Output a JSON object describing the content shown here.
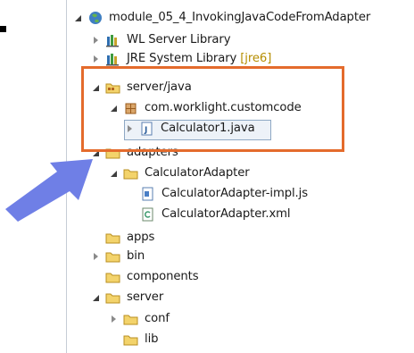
{
  "tree": {
    "root": {
      "label": "module_05_4_InvokingJavaCodeFromAdapter",
      "icon": "project-globe-icon"
    },
    "items": [
      {
        "label": "WL Server Library",
        "icon": "library-icon"
      },
      {
        "label": "JRE System Library",
        "decoration": "[jre6]",
        "icon": "library-icon"
      },
      {
        "label": "server/java",
        "icon": "source-folder-icon"
      },
      {
        "label": "com.worklight.customcode",
        "icon": "package-icon"
      },
      {
        "label": "Calculator1.java",
        "icon": "java-file-icon"
      },
      {
        "label": "adapters",
        "icon": "folder-icon"
      },
      {
        "label": "CalculatorAdapter",
        "icon": "folder-icon"
      },
      {
        "label": "CalculatorAdapter-impl.js",
        "icon": "js-file-icon"
      },
      {
        "label": "CalculatorAdapter.xml",
        "icon": "xml-file-icon"
      },
      {
        "label": "apps",
        "icon": "folder-icon"
      },
      {
        "label": "bin",
        "icon": "folder-icon"
      },
      {
        "label": "components",
        "icon": "folder-icon"
      },
      {
        "label": "server",
        "icon": "folder-icon"
      },
      {
        "label": "conf",
        "icon": "folder-icon"
      },
      {
        "label": "lib",
        "icon": "folder-icon"
      }
    ]
  },
  "colors": {
    "highlight_box": "#e46b2c",
    "pointer_arrow": "#6f7fe6",
    "selection": "#edf2f8"
  }
}
